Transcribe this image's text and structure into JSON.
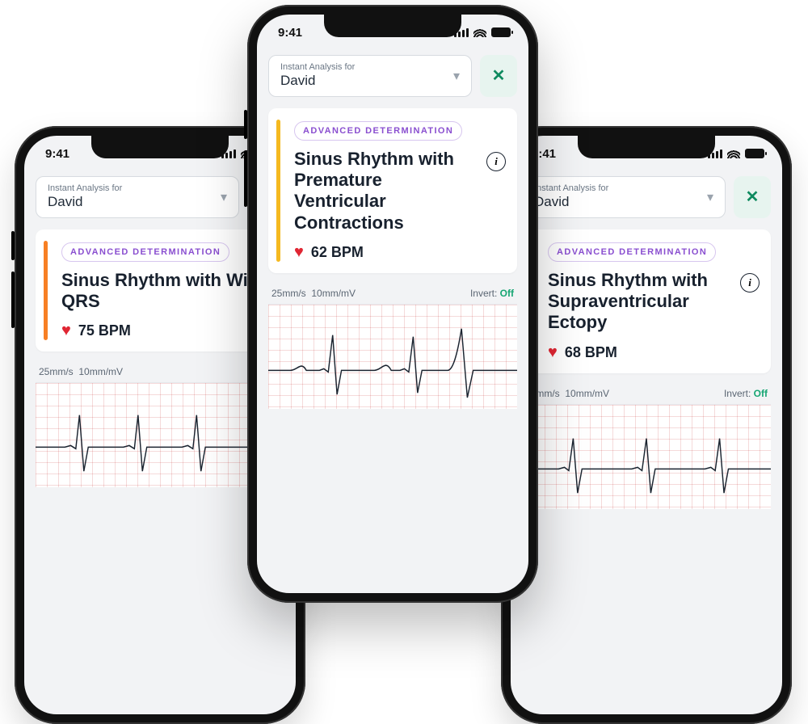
{
  "status": {
    "time": "9:41"
  },
  "selector": {
    "label": "Instant Analysis for",
    "name": "David"
  },
  "badge": "ADVANCED DETERMINATION",
  "ecg_scale": {
    "speed": "25mm/s",
    "gain": "10mm/mV",
    "invert_label": "Invert:",
    "invert_value": "Off"
  },
  "phones": {
    "left": {
      "title": "Sinus Rhythm with Wide QRS",
      "bpm": "75 BPM",
      "bar_color": "#f77f24"
    },
    "center": {
      "title": "Sinus Rhythm with Premature Ventricular Contractions",
      "bpm": "62 BPM",
      "bar_color": "#f5b920"
    },
    "right": {
      "title": "Sinus Rhythm with Supraventricular Ectopy",
      "bpm": "68 BPM",
      "bar_color": "#f5b920"
    }
  }
}
